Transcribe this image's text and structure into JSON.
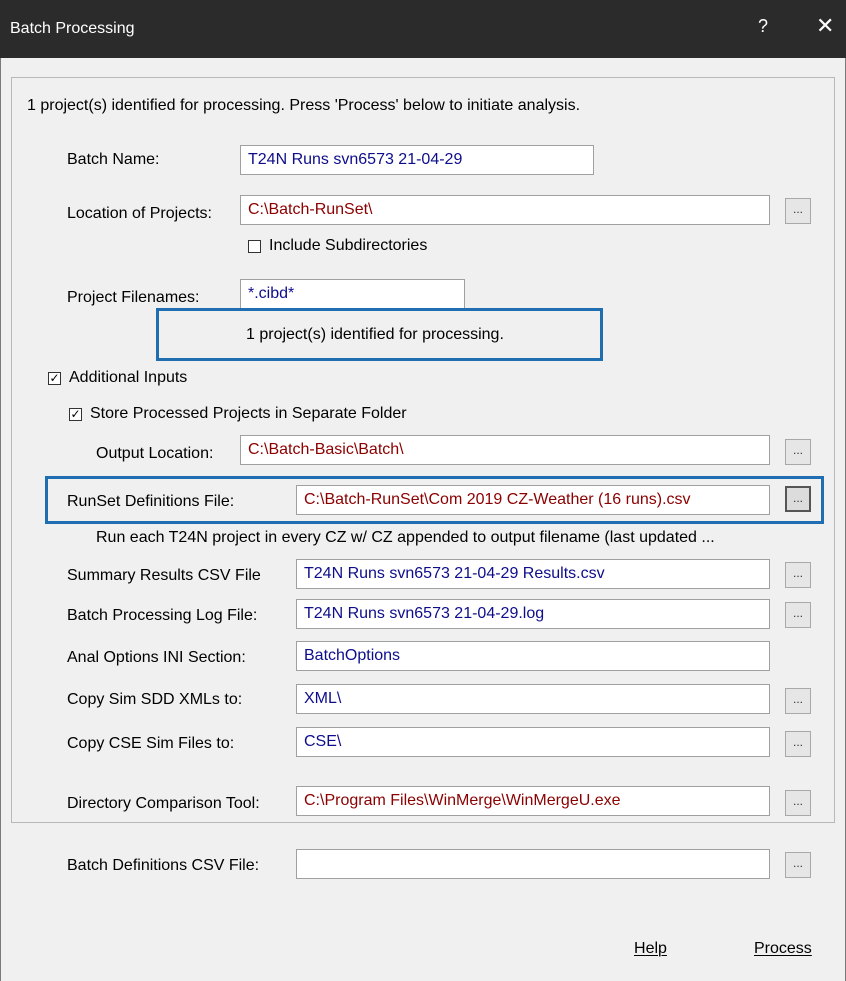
{
  "window": {
    "title": "Batch Processing",
    "help": "?",
    "close": "✕"
  },
  "status_text": "1 project(s) identified for processing.  Press 'Process' below to initiate analysis.",
  "batch_name": {
    "label": "Batch Name:",
    "value": "T24N Runs svn6573 21-04-29"
  },
  "location": {
    "label": "Location of Projects:",
    "value": "C:\\Batch-RunSet\\",
    "browse": "..."
  },
  "include_subdirs": {
    "label": "Include Subdirectories",
    "checked": false
  },
  "filenames": {
    "label": "Project Filenames:",
    "value": "*.cibd*",
    "identified": "1 project(s) identified for processing."
  },
  "additional_inputs": {
    "label": "Additional Inputs",
    "checked": true,
    "check_glyph": "✓"
  },
  "store_separate": {
    "label": "Store Processed Projects in Separate Folder",
    "checked": true,
    "check_glyph": "✓"
  },
  "output_location": {
    "label": "Output Location:",
    "value": "C:\\Batch-Basic\\Batch\\",
    "browse": "..."
  },
  "runset": {
    "label": "RunSet Definitions File:",
    "value": "C:\\Batch-RunSet\\Com 2019 CZ-Weather (16 runs).csv",
    "browse": "...",
    "description": "Run each T24N project in every CZ w/ CZ appended to output filename (last updated ..."
  },
  "summary_csv": {
    "label": "Summary Results CSV File",
    "value": "T24N Runs svn6573 21-04-29 Results.csv",
    "browse": "..."
  },
  "log_file": {
    "label": "Batch Processing Log File:",
    "value": "T24N Runs svn6573 21-04-29.log",
    "browse": "..."
  },
  "anal_options": {
    "label": "Anal Options INI Section:",
    "value": "BatchOptions"
  },
  "copy_sdd": {
    "label": "Copy Sim SDD XMLs to:",
    "value": "XML\\",
    "browse": "..."
  },
  "copy_cse": {
    "label": "Copy CSE Sim Files to:",
    "value": "CSE\\",
    "browse": "..."
  },
  "compare_tool": {
    "label": "Directory Comparison Tool:",
    "value": "C:\\Program Files\\WinMerge\\WinMergeU.exe",
    "browse": "..."
  },
  "batch_defs": {
    "label": "Batch Definitions CSV File:",
    "value": "",
    "browse": "..."
  },
  "buttons": {
    "help_mnemonic": "H",
    "help_rest": "elp",
    "process_mnemonic": "P",
    "process_rest": "rocess"
  }
}
